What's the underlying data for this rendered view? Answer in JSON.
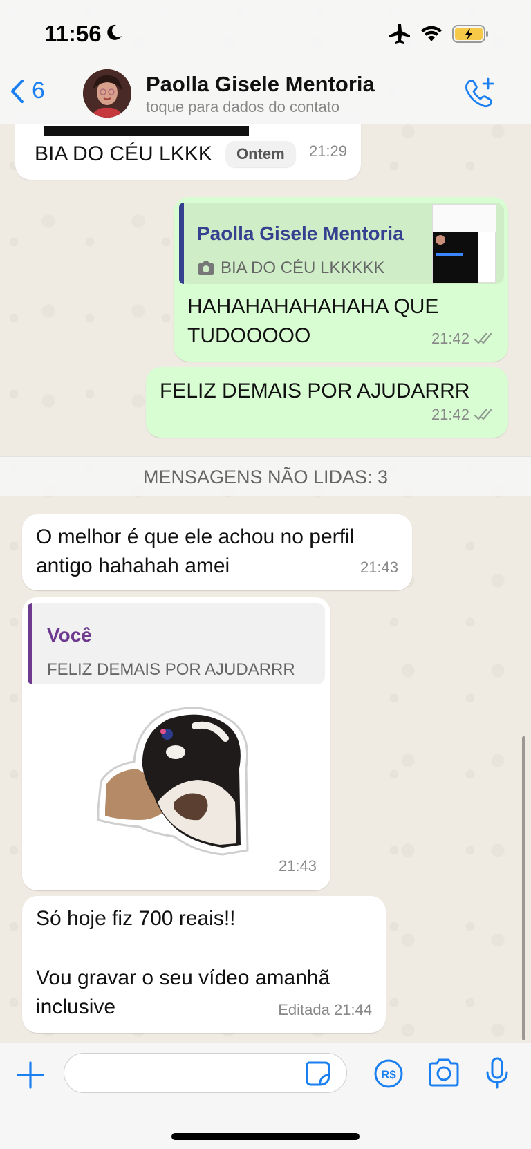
{
  "status": {
    "time": "11:56"
  },
  "header": {
    "back_count": "6",
    "contact_name": "Paolla Gisele Mentoria",
    "contact_subtitle": "toque para dados do contato"
  },
  "date_pill": "Ontem",
  "unread_banner": "MENSAGENS NÃO LIDAS: 3",
  "messages": [
    {
      "text": "BIA DO CÉU LKKK",
      "time": "21:29"
    },
    {
      "quote_name": "Paolla Gisele Mentoria",
      "quote_text": "BIA DO CÉU LKKKKK",
      "text_line1": "HAHAHAHAHAHAHA QUE",
      "text_line2": "TUDOOOOO",
      "time": "21:42"
    },
    {
      "text": "FELIZ DEMAIS POR AJUDARRR",
      "time": "21:42"
    },
    {
      "text_line1": "O melhor é que ele achou no perfil",
      "text_line2": "antigo hahahah amei",
      "time": "21:43"
    },
    {
      "quote_name": "Você",
      "quote_text": "FELIZ DEMAIS POR AJUDARRR",
      "time": "21:43"
    },
    {
      "text_line1": "Só hoje fiz 700 reais!!",
      "text_line3": "Vou gravar o seu vídeo amanhã",
      "text_line4": "inclusive",
      "edited_time": "Editada 21:44"
    }
  ],
  "colors": {
    "accent": "#1a7ff0",
    "outgoing": "#d9fdd3",
    "incoming": "#ffffff",
    "quote_blue": "#35408f",
    "quote_purple": "#6e3a8f",
    "read_tick": "#8f9a8f"
  },
  "icons": [
    "moon-icon",
    "airplane-icon",
    "wifi-icon",
    "battery-icon",
    "chevron-left-icon",
    "phone-add-icon",
    "camera-icon",
    "plus-icon",
    "sticker-icon",
    "payment-icon",
    "mic-icon",
    "double-check-icon"
  ]
}
